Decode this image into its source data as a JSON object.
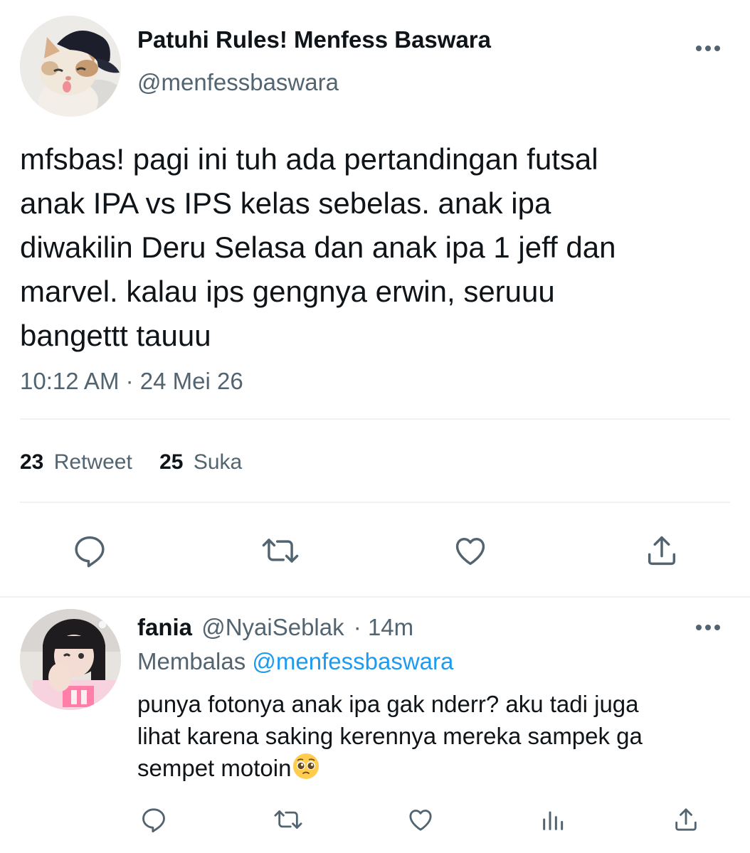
{
  "tweet": {
    "author_name": "Patuhi Rules! Menfess Baswara",
    "author_handle": "@menfessbaswara",
    "text_lines": [
      "mfsbas! pagi ini tuh ada pertandingan futsal",
      "anak IPA vs IPS kelas sebelas. anak ipa",
      "diwakilin Deru Selasa dan anak ipa 1 jeff dan",
      "marvel. kalau ips gengnya erwin, seruuu",
      "bangettt tauuu"
    ],
    "timestamp": "10:12 AM · 24 Mei 26",
    "retweet_count": "23",
    "retweet_label": "Retweet",
    "like_count": "25",
    "like_label": "Suka",
    "actions": [
      "reply-icon",
      "retweet-icon",
      "like-icon",
      "share-icon"
    ]
  },
  "reply": {
    "author_name": "fania",
    "author_handle": "@NyaiSeblak",
    "time": "· 14m",
    "replying_prefix": "Membalas",
    "replying_to": "@menfessbaswara",
    "text_lines": [
      "punya fotonya anak ipa gak nderr? aku tadi juga",
      "lihat karena saking kerennya mereka sampek ga",
      "sempet motoin"
    ],
    "emoji": "pleading-face",
    "actions": [
      "reply-icon",
      "retweet-icon",
      "like-icon",
      "analytics-icon",
      "share-icon"
    ]
  },
  "colors": {
    "text": "#0f1419",
    "secondary": "#536471",
    "link": "#1d9bf0",
    "divider": "#eff3f4"
  }
}
